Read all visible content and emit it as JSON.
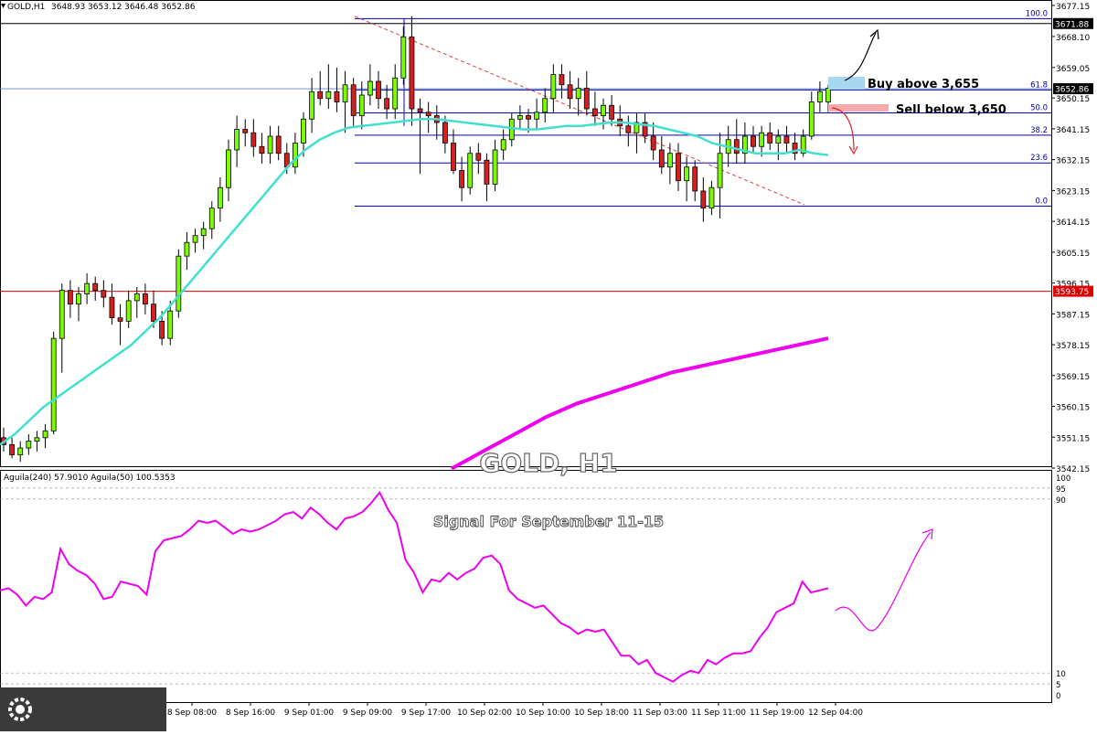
{
  "header": {
    "symbol": "GOLD,H1",
    "ohlc": "3648.93 3653.12 3646.48 3652.86"
  },
  "watermark": {
    "title": "GOLD, H1",
    "subtitle": "Signal For September 11-15"
  },
  "annotations": {
    "buy": "Buy above 3,655",
    "sell": "Sell below 3,650"
  },
  "colors": {
    "bull": "#7CFC00",
    "bear": "#d62020",
    "ma21": "#40E0D0",
    "ma200": "#ee00ee",
    "fib": "#0000cc",
    "resistance": "#000000",
    "support": "#e00000",
    "osc": "#ee00ee",
    "buy_box": "#a8d8f0",
    "sell_box": "#f4aaaa"
  },
  "chart_data": [
    {
      "type": "candlestick",
      "title": "GOLD,H1",
      "ylim": [
        3542.15,
        3677.15
      ],
      "y_ticks": [
        "3677.15",
        "3668.10",
        "3659.05",
        "3650.15",
        "3641.15",
        "3632.15",
        "3623.15",
        "3614.15",
        "3605.15",
        "3596.15",
        "3587.15",
        "3578.15",
        "3569.15",
        "3560.15",
        "3551.15",
        "3542.15"
      ],
      "x_ticks": [
        "8 Sep 08:00",
        "8 Sep 16:00",
        "9 Sep 01:00",
        "9 Sep 09:00",
        "9 Sep 17:00",
        "10 Sep 02:00",
        "10 Sep 10:00",
        "10 Sep 18:00",
        "11 Sep 03:00",
        "11 Sep 11:00",
        "11 Sep 19:00",
        "12 Sep 04:00"
      ],
      "last_price": "3652.86",
      "resistance_label": "3671.88",
      "support_label": "3593.75",
      "fibonacci": [
        {
          "level": "100.0",
          "price": 3673.3
        },
        {
          "level": "61.8",
          "price": 3652.5
        },
        {
          "level": "50.0",
          "price": 3645.8
        },
        {
          "level": "38.2",
          "price": 3639.3
        },
        {
          "level": "23.6",
          "price": 3631.2
        },
        {
          "level": "0.0",
          "price": 3618.6
        }
      ],
      "candles": [
        [
          3551,
          3554,
          3547,
          3549
        ],
        [
          3549,
          3551,
          3545,
          3546
        ],
        [
          3546,
          3550,
          3544,
          3548
        ],
        [
          3548,
          3552,
          3546,
          3550
        ],
        [
          3550,
          3553,
          3547,
          3551
        ],
        [
          3551,
          3555,
          3548,
          3553
        ],
        [
          3553,
          3582,
          3552,
          3580
        ],
        [
          3580,
          3596,
          3570,
          3594
        ],
        [
          3594,
          3597,
          3586,
          3590
        ],
        [
          3590,
          3595,
          3585,
          3593
        ],
        [
          3593,
          3599,
          3590,
          3596
        ],
        [
          3596,
          3598,
          3591,
          3594
        ],
        [
          3594,
          3597,
          3589,
          3592
        ],
        [
          3592,
          3596,
          3584,
          3586
        ],
        [
          3586,
          3590,
          3578,
          3585
        ],
        [
          3585,
          3594,
          3583,
          3591
        ],
        [
          3591,
          3595,
          3586,
          3593
        ],
        [
          3593,
          3596,
          3587,
          3590
        ],
        [
          3590,
          3594,
          3583,
          3585
        ],
        [
          3585,
          3588,
          3578,
          3580
        ],
        [
          3580,
          3591,
          3578,
          3588
        ],
        [
          3588,
          3606,
          3586,
          3604
        ],
        [
          3604,
          3611,
          3600,
          3608
        ],
        [
          3608,
          3612,
          3605,
          3610
        ],
        [
          3610,
          3614,
          3606,
          3612
        ],
        [
          3612,
          3620,
          3609,
          3618
        ],
        [
          3618,
          3627,
          3614,
          3624
        ],
        [
          3624,
          3638,
          3620,
          3635
        ],
        [
          3635,
          3645,
          3630,
          3641
        ],
        [
          3641,
          3644,
          3636,
          3640
        ],
        [
          3640,
          3644,
          3633,
          3636
        ],
        [
          3636,
          3640,
          3631,
          3634
        ],
        [
          3634,
          3642,
          3631,
          3639
        ],
        [
          3639,
          3642,
          3632,
          3634
        ],
        [
          3634,
          3637,
          3628,
          3630
        ],
        [
          3630,
          3640,
          3628,
          3637
        ],
        [
          3637,
          3646,
          3633,
          3644
        ],
        [
          3644,
          3656,
          3640,
          3652
        ],
        [
          3652,
          3658,
          3648,
          3650
        ],
        [
          3650,
          3660,
          3647,
          3652
        ],
        [
          3652,
          3659,
          3646,
          3649
        ],
        [
          3649,
          3658,
          3640,
          3654
        ],
        [
          3654,
          3656,
          3642,
          3645
        ],
        [
          3645,
          3655,
          3641,
          3651
        ],
        [
          3651,
          3660,
          3648,
          3655
        ],
        [
          3655,
          3658,
          3647,
          3650
        ],
        [
          3650,
          3654,
          3644,
          3647
        ],
        [
          3647,
          3660,
          3644,
          3656
        ],
        [
          3656,
          3671,
          3654,
          3668
        ],
        [
          3668,
          3674,
          3642,
          3647
        ],
        [
          3647,
          3650,
          3628,
          3646
        ],
        [
          3646,
          3649,
          3640,
          3645
        ],
        [
          3645,
          3648,
          3638,
          3643
        ],
        [
          3643,
          3645,
          3634,
          3637
        ],
        [
          3637,
          3641,
          3628,
          3629
        ],
        [
          3629,
          3633,
          3620,
          3624
        ],
        [
          3624,
          3636,
          3622,
          3634
        ],
        [
          3634,
          3637,
          3628,
          3632
        ],
        [
          3632,
          3634,
          3620,
          3625
        ],
        [
          3625,
          3638,
          3623,
          3635
        ],
        [
          3635,
          3641,
          3632,
          3638
        ],
        [
          3638,
          3646,
          3636,
          3644
        ],
        [
          3644,
          3648,
          3641,
          3645
        ],
        [
          3645,
          3647,
          3640,
          3644
        ],
        [
          3644,
          3650,
          3641,
          3646
        ],
        [
          3646,
          3653,
          3643,
          3650
        ],
        [
          3650,
          3660,
          3646,
          3657
        ],
        [
          3657,
          3660,
          3650,
          3654
        ],
        [
          3654,
          3658,
          3647,
          3650
        ],
        [
          3650,
          3656,
          3645,
          3653
        ],
        [
          3653,
          3658,
          3645,
          3647
        ],
        [
          3647,
          3652,
          3642,
          3645
        ],
        [
          3645,
          3650,
          3641,
          3648
        ],
        [
          3648,
          3651,
          3642,
          3644
        ],
        [
          3644,
          3648,
          3639,
          3642
        ],
        [
          3642,
          3645,
          3636,
          3640
        ],
        [
          3640,
          3646,
          3634,
          3643
        ],
        [
          3643,
          3646,
          3637,
          3639
        ],
        [
          3639,
          3643,
          3632,
          3635
        ],
        [
          3635,
          3639,
          3628,
          3630
        ],
        [
          3630,
          3637,
          3625,
          3634
        ],
        [
          3634,
          3637,
          3623,
          3626
        ],
        [
          3626,
          3633,
          3620,
          3630
        ],
        [
          3630,
          3632,
          3620,
          3623
        ],
        [
          3623,
          3627,
          3614,
          3618
        ],
        [
          3618,
          3626,
          3616,
          3624
        ],
        [
          3624,
          3640,
          3615,
          3634
        ],
        [
          3634,
          3642,
          3630,
          3638
        ],
        [
          3638,
          3644,
          3631,
          3634
        ],
        [
          3634,
          3643,
          3631,
          3639
        ],
        [
          3639,
          3642,
          3634,
          3636
        ],
        [
          3636,
          3642,
          3633,
          3640
        ],
        [
          3640,
          3643,
          3635,
          3637
        ],
        [
          3637,
          3641,
          3632,
          3639
        ],
        [
          3639,
          3642,
          3634,
          3637
        ],
        [
          3637,
          3640,
          3632,
          3634
        ],
        [
          3634,
          3641,
          3633,
          3639
        ],
        [
          3639,
          3652,
          3638,
          3649
        ],
        [
          3649,
          3655,
          3646,
          3652
        ],
        [
          3649,
          3654,
          3646,
          3653
        ]
      ],
      "ma21": [
        3549,
        3552,
        3556,
        3560,
        3563,
        3566,
        3569,
        3572,
        3575,
        3578,
        3582,
        3586,
        3591,
        3596,
        3601,
        3606,
        3611,
        3616,
        3621,
        3626,
        3631,
        3635,
        3638,
        3640,
        3641.5,
        3642,
        3642.5,
        3643,
        3643.5,
        3644,
        3644,
        3643.5,
        3643,
        3642.5,
        3642,
        3641.5,
        3641,
        3641,
        3641.5,
        3642,
        3642,
        3642.5,
        3643,
        3643,
        3642.5,
        3642,
        3641,
        3640,
        3639,
        3637,
        3636,
        3635,
        3634,
        3634,
        3634,
        3635,
        3634,
        3633.5
      ],
      "ma200": [
        3542,
        3547,
        3552,
        3557,
        3561,
        3564,
        3567,
        3570,
        3572,
        3574,
        3576,
        3578,
        3580
      ],
      "forecast": [
        "up",
        "down"
      ]
    },
    {
      "type": "line",
      "title": "Aguila(240) 57.9010 Aguila(50) 100.5353",
      "ylim": [
        0,
        100
      ],
      "y_ticks": [
        "100",
        "95",
        "90",
        "10",
        "5",
        "0"
      ],
      "series": [
        {
          "name": "Aguila(240)",
          "values": [
            48,
            49,
            46,
            41,
            45,
            44,
            47,
            67,
            60,
            57,
            55,
            51,
            44,
            45,
            52,
            51,
            50,
            46,
            66,
            71,
            72,
            73,
            76,
            80,
            79,
            80,
            77,
            74,
            76,
            75,
            76,
            78,
            80,
            83,
            84,
            81,
            86,
            83,
            79,
            76,
            81,
            82,
            84,
            88,
            93,
            85,
            79,
            62,
            56,
            47,
            53,
            52,
            56,
            53,
            56,
            58,
            63,
            64,
            60,
            48,
            44,
            42,
            40,
            41,
            37,
            33,
            31,
            28,
            30,
            29,
            30,
            24,
            18,
            18,
            14,
            16,
            10,
            8,
            6,
            9,
            11,
            10,
            16,
            14,
            17,
            19,
            19,
            20,
            26,
            31,
            38,
            40,
            42,
            52,
            47,
            48,
            49
          ]
        }
      ],
      "forecast": "up"
    }
  ]
}
